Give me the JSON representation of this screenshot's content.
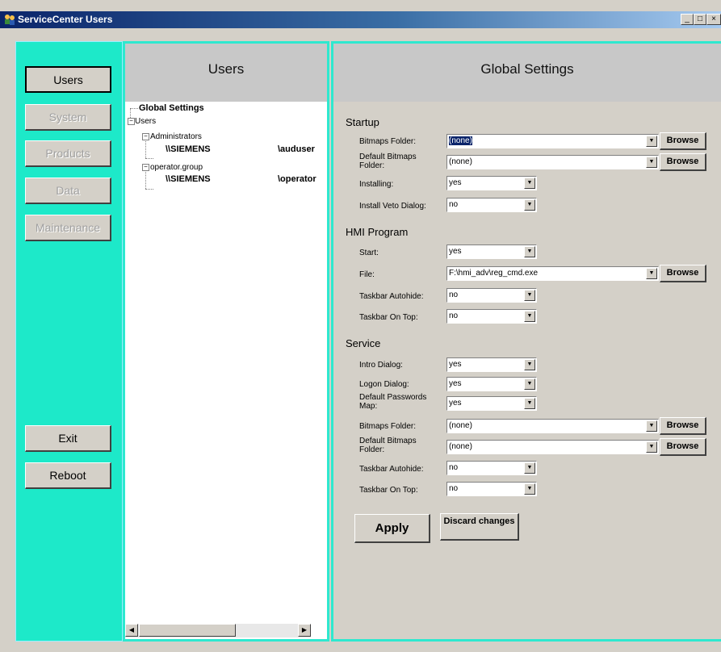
{
  "window": {
    "title": "ServiceCenter Users"
  },
  "nav": {
    "users": "Users",
    "system": "System",
    "products": "Products",
    "data": "Data",
    "maintenance": "Maintenance",
    "exit": "Exit",
    "reboot": "Reboot"
  },
  "users_panel": {
    "title": "Users",
    "tree": {
      "global_settings": "Global Settings",
      "users": "Users",
      "administrators": "Administrators",
      "admin_domain": "\\\\SIEMENS",
      "admin_user": "\\auduser",
      "operator_group": "operator.group",
      "op_domain": "\\\\SIEMENS",
      "op_user": "\\operator"
    }
  },
  "settings": {
    "title": "Global Settings",
    "startup": {
      "heading": "Startup",
      "bitmaps_folder": {
        "label": "Bitmaps Folder:",
        "value": "(none)"
      },
      "default_bitmaps_folder": {
        "label": "Default Bitmaps Folder:",
        "value": "(none)"
      },
      "installing": {
        "label": "Installing:",
        "value": "yes"
      },
      "install_veto": {
        "label": "Install Veto Dialog:",
        "value": "no"
      }
    },
    "hmi": {
      "heading": "HMI Program",
      "start": {
        "label": "Start:",
        "value": "yes"
      },
      "file": {
        "label": "File:",
        "value": "F:\\hmi_adv\\reg_cmd.exe"
      },
      "taskbar_autohide": {
        "label": "Taskbar Autohide:",
        "value": "no"
      },
      "taskbar_on_top": {
        "label": "Taskbar On Top:",
        "value": "no"
      }
    },
    "service": {
      "heading": "Service",
      "intro_dialog": {
        "label": "Intro Dialog:",
        "value": "yes"
      },
      "logon_dialog": {
        "label": "Logon Dialog:",
        "value": "yes"
      },
      "default_passwords_map": {
        "label": "Default Passwords Map:",
        "value": "yes"
      },
      "bitmaps_folder": {
        "label": "Bitmaps Folder:",
        "value": "(none)"
      },
      "default_bitmaps_folder": {
        "label": "Default Bitmaps Folder:",
        "value": "(none)"
      },
      "taskbar_autohide": {
        "label": "Taskbar Autohide:",
        "value": "no"
      },
      "taskbar_on_top": {
        "label": "Taskbar On Top:",
        "value": "no"
      }
    },
    "browse_label": "Browse",
    "apply_label": "Apply",
    "discard_label": "Discard changes"
  },
  "icons": {
    "minimize": "minimize-icon",
    "maximize": "maximize-icon",
    "close": "close-icon",
    "app": "users-app-icon"
  }
}
